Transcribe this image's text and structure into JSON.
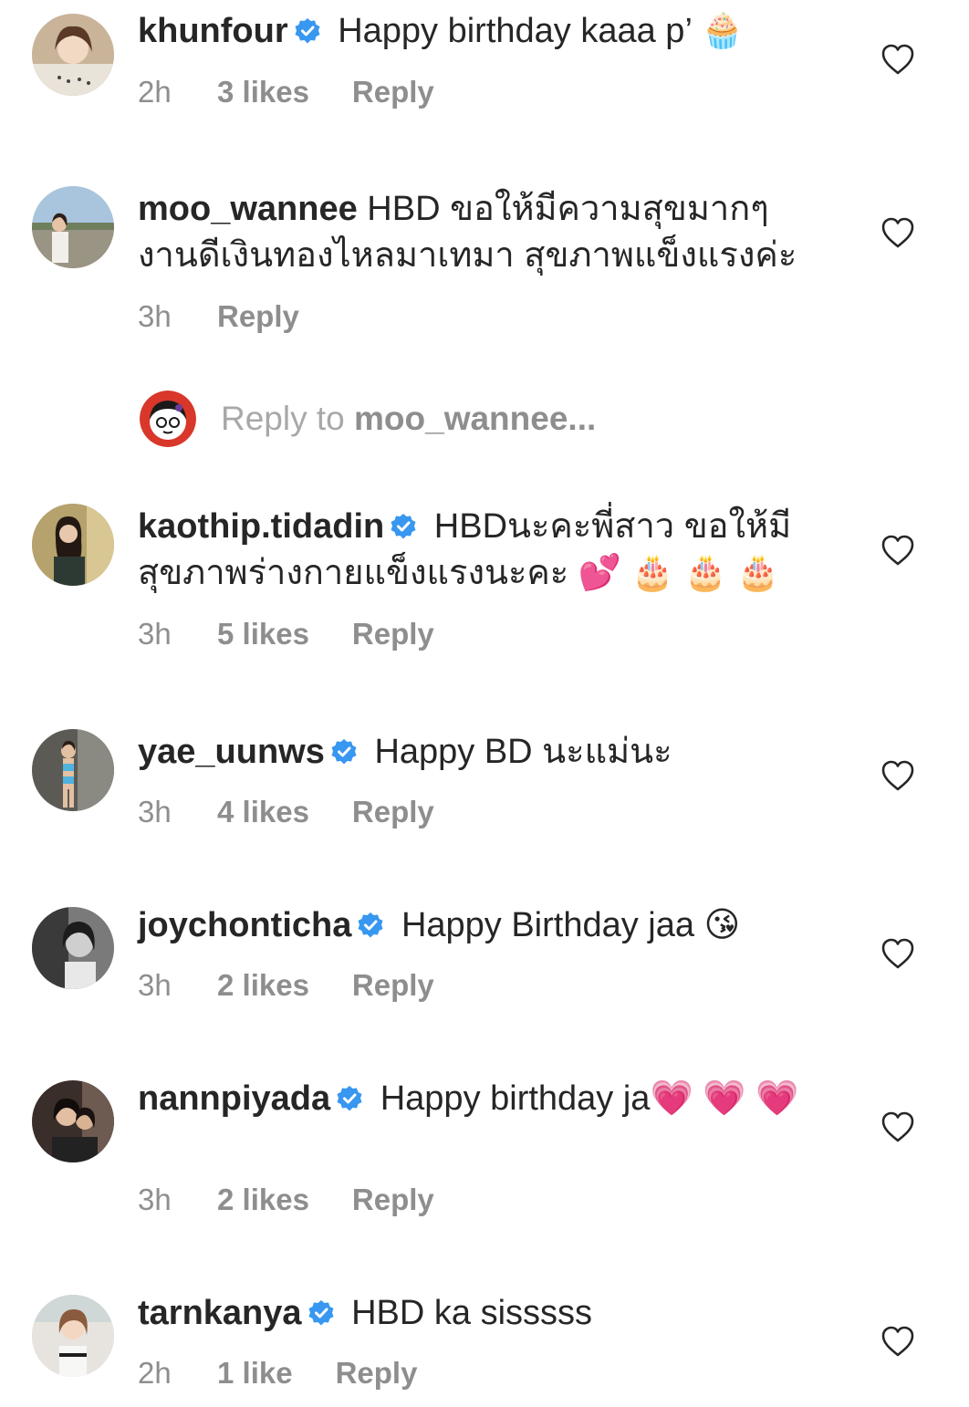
{
  "comments": [
    {
      "username": "khunfour",
      "verified": true,
      "text": "Happy birthday kaaa p’",
      "emoji": "🧁",
      "time": "2h",
      "likes": "3 likes",
      "reply": "Reply"
    },
    {
      "username": "moo_wannee",
      "verified": false,
      "text": "HBD ขอให้มีความสุขมากๆ งานดีเงินทองไหลมาเทมา สุขภาพแข็งแรงค่ะ",
      "emoji": "",
      "time": "3h",
      "likes": "",
      "reply": "Reply"
    },
    {
      "username": "kaothip.tidadin",
      "verified": true,
      "text": "HBDนะคะพี่สาว ขอให้มีสุขภาพร่างกายแข็งแรงนะคะ",
      "emoji": "💕 🎂 🎂 🎂",
      "time": "3h",
      "likes": "5 likes",
      "reply": "Reply"
    },
    {
      "username": "yae_uunws",
      "verified": true,
      "text": "Happy BD นะแม่นะ",
      "emoji": "",
      "time": "3h",
      "likes": "4 likes",
      "reply": "Reply"
    },
    {
      "username": "joychonticha",
      "verified": true,
      "text": "Happy Birthday jaa",
      "emoji": "😘",
      "time": "3h",
      "likes": "2 likes",
      "reply": "Reply"
    },
    {
      "username": "nannpiyada",
      "verified": true,
      "text": "Happy birthday ja",
      "emoji": "💗 💗 💗",
      "time": "3h",
      "likes": "2 likes",
      "reply": "Reply"
    },
    {
      "username": "tarnkanya",
      "verified": true,
      "text": "HBD ka sisssss",
      "emoji": "",
      "time": "2h",
      "likes": "1 like",
      "reply": "Reply"
    }
  ],
  "reply_box": {
    "prefix": "Reply to ",
    "target": "moo_wannee",
    "suffix": "..."
  },
  "colors": {
    "text": "#262626",
    "meta": "#8e8e8e",
    "verified": "#3897f0",
    "heart": "#262626"
  },
  "icons": {
    "verified": "verified-badge-icon",
    "like": "heart-outline-icon"
  }
}
